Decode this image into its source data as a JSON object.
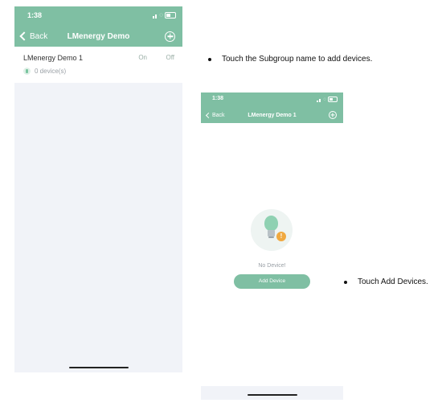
{
  "phone1": {
    "time": "1:38",
    "back_label": "Back",
    "title": "LMenergy Demo",
    "group": {
      "name": "LMenergy Demo 1",
      "on_label": "On",
      "off_label": "Off",
      "device_count": "0 device(s)"
    }
  },
  "phone2": {
    "time": "1:38",
    "back_label": "Back",
    "title": "LMenergy Demo 1",
    "empty_text": "No Device!",
    "add_button_label": "Add Device"
  },
  "instructions": [
    "Touch the Subgroup name to add devices.",
    "Touch Add Devices."
  ],
  "colors": {
    "header_green": "#7fbfa3",
    "screen_background": "#f1f3f8",
    "warning_orange": "#f0a940"
  },
  "icons": [
    "back-chevron-icon",
    "add-circle-icon",
    "device-icon",
    "light-bulb-icon",
    "warning-icon",
    "signal-icon",
    "wifi-icon",
    "battery-icon"
  ]
}
